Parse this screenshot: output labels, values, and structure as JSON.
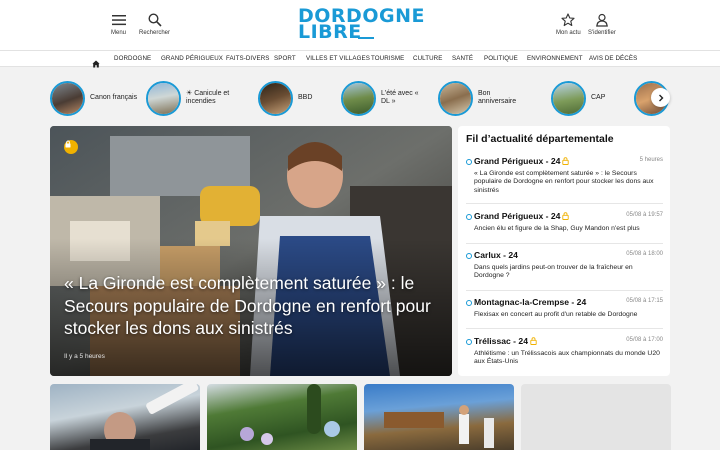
{
  "header": {
    "menu_label": "Menu",
    "search_label": "Rechercher",
    "logo_line1": "DORDOGNE",
    "logo_line2": "LIBRE",
    "account_menu_label": "Mon actu",
    "login_label": "S'identifier"
  },
  "nav": {
    "items": [
      "DORDOGNE",
      "GRAND PÉRIGUEUX",
      "FAITS-DIVERS",
      "SPORT",
      "VILLES ET VILLAGES",
      "TOURISME",
      "CULTURE",
      "SANTÉ",
      "POLITIQUE",
      "ENVIRONNEMENT",
      "AVIS DE DÉCÈS"
    ]
  },
  "stories": [
    {
      "label": "Canon français",
      "icon": "emoji-glyph"
    },
    {
      "label": "☀ Canicule et incendies",
      "icon": "sun"
    },
    {
      "label": "BBD",
      "icon": "emoji-glyph"
    },
    {
      "label": "L'été avec « DL »",
      "icon": "emoji-glyph"
    },
    {
      "label": "Bon anniversaire",
      "icon": "emoji-glyph"
    },
    {
      "label": "CAP",
      "icon": "emoji-glyph"
    }
  ],
  "hero": {
    "title": "« La Gironde est complètement saturée » : le Secours populaire de Dordogne en renfort pour stocker les dons aux sinistrés",
    "time": "Il y a 5 heures"
  },
  "feed": {
    "title": "Fil d’actualité départementale",
    "items": [
      {
        "location": "Grand Périgueux - 24",
        "locked": true,
        "time": "5 heures",
        "text": "« La Gironde est complètement saturée » : le Secours populaire de Dordogne en renfort pour stocker les dons aux sinistrés"
      },
      {
        "location": "Grand Périgueux - 24",
        "locked": true,
        "time": "05/08 à 19:57",
        "text": "Ancien élu et figure de la Shap, Guy Mandon n'est plus"
      },
      {
        "location": "Carlux - 24",
        "locked": false,
        "time": "05/08 à 18:00",
        "text": "Dans quels jardins peut-on trouver de la fraîcheur en Dordogne ?"
      },
      {
        "location": "Montagnac-la-Crempse - 24",
        "locked": false,
        "time": "05/08 à 17:15",
        "text": "Flexisax en concert au profit d'un retable de Dordogne"
      },
      {
        "location": "Trélissac - 24",
        "locked": true,
        "time": "05/08 à 17:00",
        "text": "Athlétisme : un Trélissacois aux championnats du monde U20 aux États-Unis"
      }
    ]
  },
  "colors": {
    "brand": "#1a9ad6",
    "lock": "#f0b100"
  }
}
